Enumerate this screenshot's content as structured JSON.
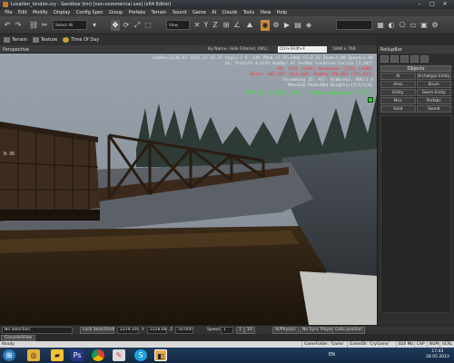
{
  "window": {
    "title": "Location_london.cry - Sandbox (tm) [non-commercial use] (x64 Editor)"
  },
  "menu": [
    "File",
    "Edit",
    "Modify",
    "Display",
    "Config Spec",
    "Group",
    "Prefabs",
    "Terrain",
    "Sound",
    "Game",
    "AI",
    "Clouds",
    "Tools",
    "View",
    "Help"
  ],
  "toolbar": {
    "select_all": "Select All",
    "view": "View"
  },
  "subtoolbar": {
    "terrain": "Terrain",
    "texture": "Texture",
    "time_of_day": "Time Of Day"
  },
  "viewport": {
    "label": "Perspective",
    "filter": "By Name, Hide Filtered, XML)",
    "search": "Ctrl+Shift+F",
    "resolution": "1896 x 766",
    "debug": {
      "line1": "CamPos=2230.87 2232.21 43.37 Angl=-1  6 -144 ZN=0.15 ZF=2000 FC=3.32 Zoom=1.00 Speed=1.00",
      "line2": "GI: Profile 4 GiIt HudSpr GI OvrRdv Location Corisa [2,207]",
      "line3": "DP: 1293 (1294) ShadowGen:(225) (3298)",
      "line4": "Polys: 487,267 (411,360) Shadow:749,661 (741,633)",
      "line5": "Streaming IO: ACT: 0(0mreq), AVG:1 V",
      "line6": "Mem=616 Peak=804 DLights=(1/1/1/0)",
      "fps": "FPS 41.5 [38..48], frame avg over 1.0 s"
    }
  },
  "rollup": {
    "title": "RollupBar",
    "objects_header": "Objects",
    "buttons": [
      "AI",
      "Archetype Entity",
      "Area",
      "Brush",
      "Entity",
      "Geom Entity",
      "Misc",
      "Prefabs",
      "Solid",
      "Sound"
    ]
  },
  "status": {
    "selection": "No Selection",
    "lock": "Lock Selection",
    "x_label": "X",
    "x": "2229.200",
    "y_label": "Y",
    "y": "2228.68",
    "z_label": "Z",
    "z": "50.0007",
    "speed_label": "Speed",
    "speed": "1",
    "s1": "1",
    "s10": "10",
    "ai_physics": "AI/Physics",
    "no_sync": "No Sync Player",
    "goto": "Goto position"
  },
  "console_tab": "Console/View",
  "ready": {
    "text": "Ready",
    "gamefolder": "GameFolder: 'Game'",
    "gamedll": "GameDll: 'CryGame'",
    "mem": "826 Mb",
    "cap": "CAP",
    "num": "NUM",
    "scrl": "SCRL"
  },
  "taskbar": {
    "lang": "EN",
    "time": "17:43",
    "date": "28.05.2013"
  },
  "colors": {
    "accent": "#c7782a",
    "selected_tool": "#d08a3a",
    "fps_green": "#33ee33",
    "polys_red": "#ff3333"
  }
}
